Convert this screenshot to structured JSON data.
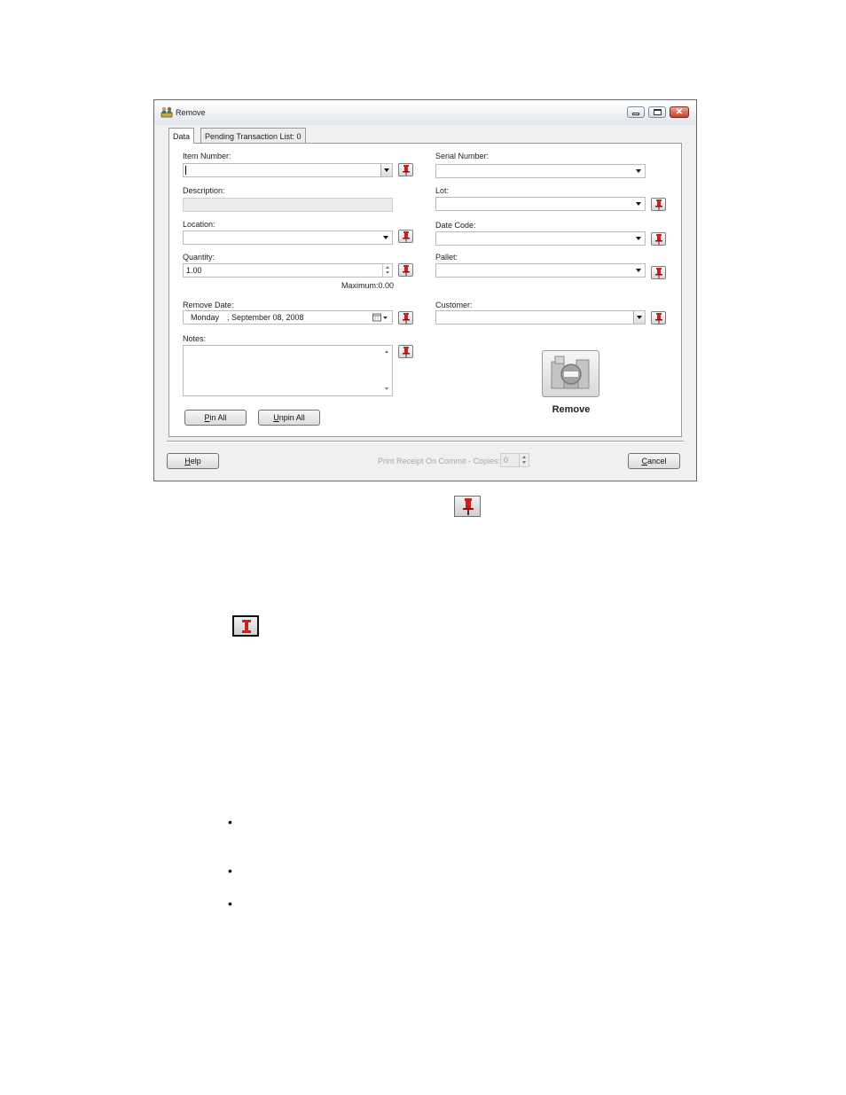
{
  "window": {
    "title": "Remove",
    "icon": "pallet-people-icon",
    "controls": [
      "minimize-icon",
      "maximize-icon",
      "close-icon"
    ],
    "close_glyph": "✕"
  },
  "tabs": [
    {
      "label": "Data",
      "active": true
    },
    {
      "label": "Pending Transaction List: 0",
      "active": false
    }
  ],
  "form": {
    "item_number": {
      "label": "Item Number:",
      "value": ""
    },
    "description": {
      "label": "Description:",
      "value": ""
    },
    "location": {
      "label": "Location:",
      "value": ""
    },
    "quantity": {
      "label": "Quantity:",
      "value": "1.00",
      "maximum": "Maximum:0.00"
    },
    "remove_date": {
      "label": "Remove Date:",
      "weekday": "Monday",
      "date": ", September 08, 2008"
    },
    "notes": {
      "label": "Notes:",
      "value": ""
    },
    "serial_number": {
      "label": "Serial Number:",
      "value": ""
    },
    "lot": {
      "label": "Lot:",
      "value": ""
    },
    "date_code": {
      "label": "Date Code:",
      "value": ""
    },
    "pallet": {
      "label": "Pallet:",
      "value": ""
    },
    "customer": {
      "label": "Customer:",
      "value": ""
    }
  },
  "buttons": {
    "pin_all": {
      "accel": "P",
      "rest": "in All"
    },
    "unpin_all": {
      "accel": "U",
      "rest": "npin All"
    },
    "remove": "Remove",
    "help": {
      "accel": "H",
      "rest": "elp"
    },
    "cancel": {
      "accel": "C",
      "rest": "ancel"
    }
  },
  "footer": {
    "print_receipt_label": "Print Receipt On Commit - Copies:",
    "copies": "0"
  },
  "colors": {
    "pin_red": "#cc1f1f",
    "window_bg": "#f0f0f0",
    "close_red": "#c43e2c"
  }
}
